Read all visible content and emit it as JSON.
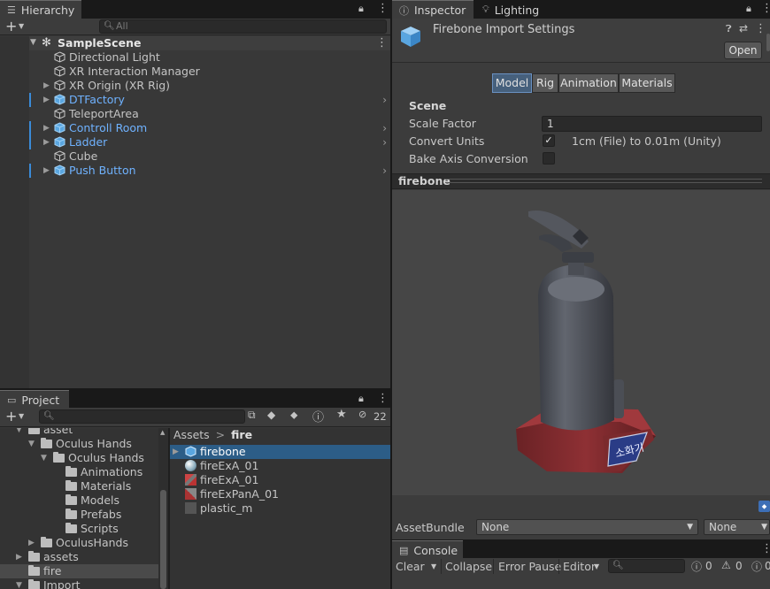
{
  "hierarchy": {
    "tab": "Hierarchy",
    "search_placeholder": "All",
    "scene": "SampleScene",
    "items": [
      {
        "label": "Directional Light",
        "blue": false,
        "arrow": false,
        "chev": false
      },
      {
        "label": "XR Interaction Manager",
        "blue": false,
        "arrow": false,
        "chev": false
      },
      {
        "label": "XR Origin (XR Rig)",
        "blue": false,
        "arrow": true,
        "chev": false
      },
      {
        "label": "DTFactory",
        "blue": true,
        "arrow": true,
        "chev": true
      },
      {
        "label": "TeleportArea",
        "blue": false,
        "arrow": false,
        "chev": false
      },
      {
        "label": "Controll Room",
        "blue": true,
        "arrow": true,
        "chev": true
      },
      {
        "label": "Ladder",
        "blue": true,
        "arrow": true,
        "chev": true
      },
      {
        "label": "Cube",
        "blue": false,
        "arrow": false,
        "chev": false
      },
      {
        "label": "Push Button",
        "blue": true,
        "arrow": true,
        "chev": true
      }
    ]
  },
  "project": {
    "tab": "Project",
    "hidden_count": "22",
    "tree": [
      {
        "label": "asset",
        "indent": 0
      },
      {
        "label": "Oculus Hands",
        "indent": 1
      },
      {
        "label": "Oculus Hands",
        "indent": 2
      },
      {
        "label": "Animations",
        "indent": 3
      },
      {
        "label": "Materials",
        "indent": 3
      },
      {
        "label": "Models",
        "indent": 3
      },
      {
        "label": "Prefabs",
        "indent": 3
      },
      {
        "label": "Scripts",
        "indent": 3
      },
      {
        "label": "OculusHands",
        "indent": 1
      },
      {
        "label": "assets",
        "indent": 0
      },
      {
        "label": "fire",
        "indent": 0
      },
      {
        "label": "Import",
        "indent": 0
      }
    ],
    "breadcrumb_root": "Assets",
    "breadcrumb_sep": ">",
    "breadcrumb_current": "fire",
    "files": [
      "firebone",
      "fireExA_01",
      "fireExA_01",
      "fireExPanA_01",
      "plastic_m"
    ]
  },
  "inspector": {
    "tab": "Inspector",
    "tab2": "Lighting",
    "title": "Firebone Import Settings",
    "open_button": "Open",
    "segments": [
      "Model",
      "Rig",
      "Animation",
      "Materials"
    ],
    "section": "Scene",
    "scale_factor_label": "Scale Factor",
    "scale_factor_value": "1",
    "convert_units_label": "Convert Units",
    "convert_units_text": "1cm (File) to 0.01m (Unity)",
    "bake_axis_label": "Bake Axis Conversion",
    "preview_title": "firebone",
    "preview_label_text": "소화기",
    "assetbundle_label": "AssetBundle",
    "assetbundle_value": "None",
    "assetbundle_variant": "None"
  },
  "console": {
    "tab": "Console",
    "clear": "Clear",
    "collapse": "Collapse",
    "error_pause": "Error Pause",
    "editor": "Editor",
    "count_errors": "0",
    "count_warnings": "0",
    "count_logs": "0"
  }
}
